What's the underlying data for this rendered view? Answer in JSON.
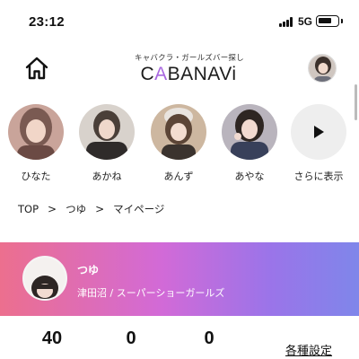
{
  "status_bar": {
    "time": "23:12",
    "network": "5G"
  },
  "header": {
    "logo_tagline": "キャバクラ・ガールズバー探し",
    "logo_text_pre": "C",
    "logo_text_accent": "A",
    "logo_text_post": "BANAVi",
    "home_icon": "home-icon",
    "accent_color": "#a867e0"
  },
  "stories": [
    {
      "name": "ひなた",
      "photo_colors": [
        "#c9a49a",
        "#7a5a52"
      ]
    },
    {
      "name": "あかね",
      "photo_colors": [
        "#d8d2cc",
        "#4a3f38"
      ]
    },
    {
      "name": "あんず",
      "photo_colors": [
        "#cdb7a0",
        "#5c4536"
      ]
    },
    {
      "name": "あやな",
      "photo_colors": [
        "#b9b4bd",
        "#38405a"
      ]
    }
  ],
  "stories_more_label": "さらに表示",
  "breadcrumb": {
    "items": [
      "TOP",
      "つゆ",
      "マイページ"
    ],
    "separator": ">"
  },
  "profile": {
    "name": "つゆ",
    "subtitle": "津田沼 / スーパーショーガールズ",
    "gradient": [
      "#ec6f8e",
      "#d26ad7",
      "#9b74e9",
      "#7f86ea"
    ]
  },
  "stats": [
    "40",
    "0",
    "0"
  ],
  "settings_label": "各種設定"
}
